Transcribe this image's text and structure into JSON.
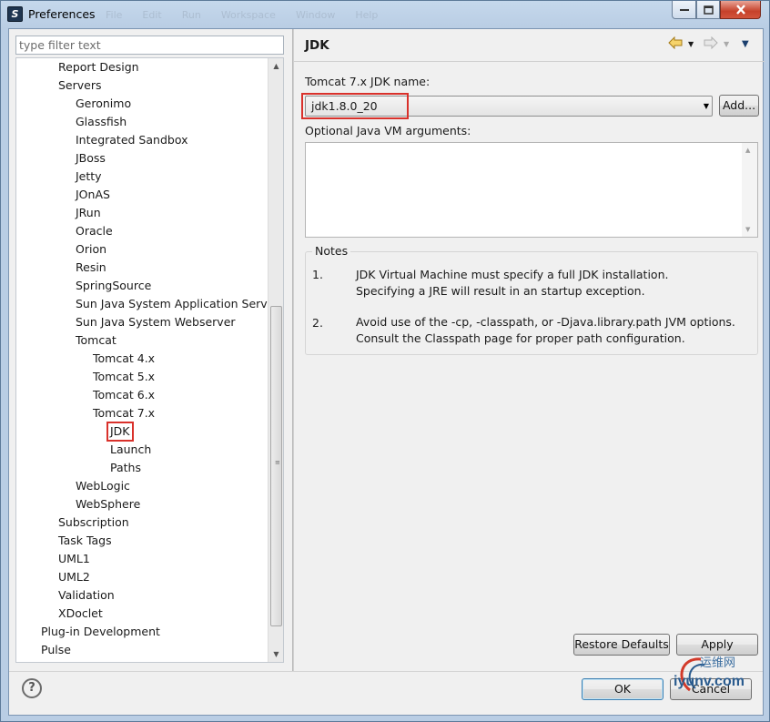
{
  "window": {
    "title": "Preferences",
    "ghost_menu": [
      "File",
      "Edit",
      "Run",
      "Workspace",
      "Window",
      "Help"
    ]
  },
  "filter": {
    "placeholder": "type filter text",
    "value": ""
  },
  "tree": {
    "items": [
      {
        "label": "Report Design",
        "level": 2
      },
      {
        "label": "Servers",
        "level": 2
      },
      {
        "label": "Geronimo",
        "level": 3
      },
      {
        "label": "Glassfish",
        "level": 3
      },
      {
        "label": "Integrated Sandbox",
        "level": 3
      },
      {
        "label": "JBoss",
        "level": 3
      },
      {
        "label": "Jetty",
        "level": 3
      },
      {
        "label": "JOnAS",
        "level": 3
      },
      {
        "label": "JRun",
        "level": 3
      },
      {
        "label": "Oracle",
        "level": 3
      },
      {
        "label": "Orion",
        "level": 3
      },
      {
        "label": "Resin",
        "level": 3
      },
      {
        "label": "SpringSource",
        "level": 3
      },
      {
        "label": "Sun Java System Application Server",
        "level": 3
      },
      {
        "label": "Sun Java System Webserver",
        "level": 3
      },
      {
        "label": "Tomcat",
        "level": 3
      },
      {
        "label": "Tomcat  4.x",
        "level": 4
      },
      {
        "label": "Tomcat  5.x",
        "level": 4
      },
      {
        "label": "Tomcat  6.x",
        "level": 4
      },
      {
        "label": "Tomcat  7.x",
        "level": 4
      },
      {
        "label": "JDK",
        "level": 5,
        "selected": true
      },
      {
        "label": "Launch",
        "level": 5
      },
      {
        "label": "Paths",
        "level": 5
      },
      {
        "label": "WebLogic",
        "level": 3
      },
      {
        "label": "WebSphere",
        "level": 3
      },
      {
        "label": "Subscription",
        "level": 2
      },
      {
        "label": "Task Tags",
        "level": 2
      },
      {
        "label": "UML1",
        "level": 2
      },
      {
        "label": "UML2",
        "level": 2
      },
      {
        "label": "Validation",
        "level": 2
      },
      {
        "label": "XDoclet",
        "level": 2
      },
      {
        "label": "Plug-in Development",
        "level": 1
      },
      {
        "label": "Pulse",
        "level": 1
      }
    ]
  },
  "page": {
    "title": "JDK",
    "jdk_label": "Tomcat  7.x JDK name:",
    "jdk_value": "jdk1.8.0_20",
    "add_button": "Add...",
    "vm_args_label": "Optional Java VM arguments:",
    "vm_args_value": "",
    "notes_title": "Notes",
    "notes": [
      {
        "num": "1.",
        "lines": [
          "JDK Virtual Machine must specify a full JDK installation.",
          "Specifying a JRE will result in an startup exception."
        ]
      },
      {
        "num": "2.",
        "lines": [
          "Avoid use of the -cp, -classpath, or -Djava.library.path JVM options.",
          "Consult the Classpath page for proper path configuration."
        ]
      }
    ],
    "restore_defaults": "Restore Defaults",
    "apply": "Apply"
  },
  "footer": {
    "help_glyph": "?",
    "ok": "OK",
    "cancel": "Cancel"
  },
  "watermark": {
    "top": "运维网",
    "bottom": "iyunv.com"
  },
  "colors": {
    "highlight": "#d9312b",
    "title_gradient": "#b9cde4"
  }
}
